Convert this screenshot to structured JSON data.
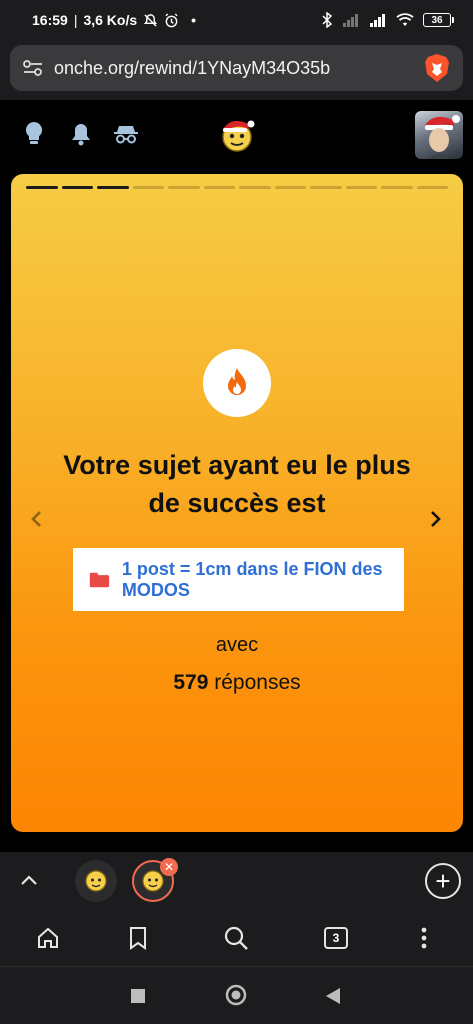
{
  "status_bar": {
    "time": "16:59",
    "speed": "3,6 Ko/s",
    "dot": "•",
    "battery": "36"
  },
  "browser": {
    "url": "onche.org/rewind/1YNayM34O35b",
    "tab_count": "3"
  },
  "icons": {
    "header": [
      "lightbulb-icon",
      "bell-icon",
      "incognito-icon"
    ],
    "toolbar": [
      "home-icon",
      "bookmark-icon",
      "search-icon",
      "tabs-icon",
      "more-icon"
    ]
  },
  "story": {
    "progress_total": 12,
    "progress_done": 3,
    "heading": "Votre sujet ayant eu le plus de succès est",
    "topic_title": "1 post = 1cm dans le FION des MODOS",
    "avec": "avec",
    "reply_count": "579",
    "reply_suffix": "réponses"
  },
  "colors": {
    "card_top": "#f6cc45",
    "card_bottom": "#fd8504",
    "topic_link": "#2f6fd6",
    "folder": "#e84a45",
    "fire": "#f46a0c",
    "tab_active": "#f06b4f"
  },
  "tab_close_glyph": "✕",
  "new_tab_glyph": "+"
}
